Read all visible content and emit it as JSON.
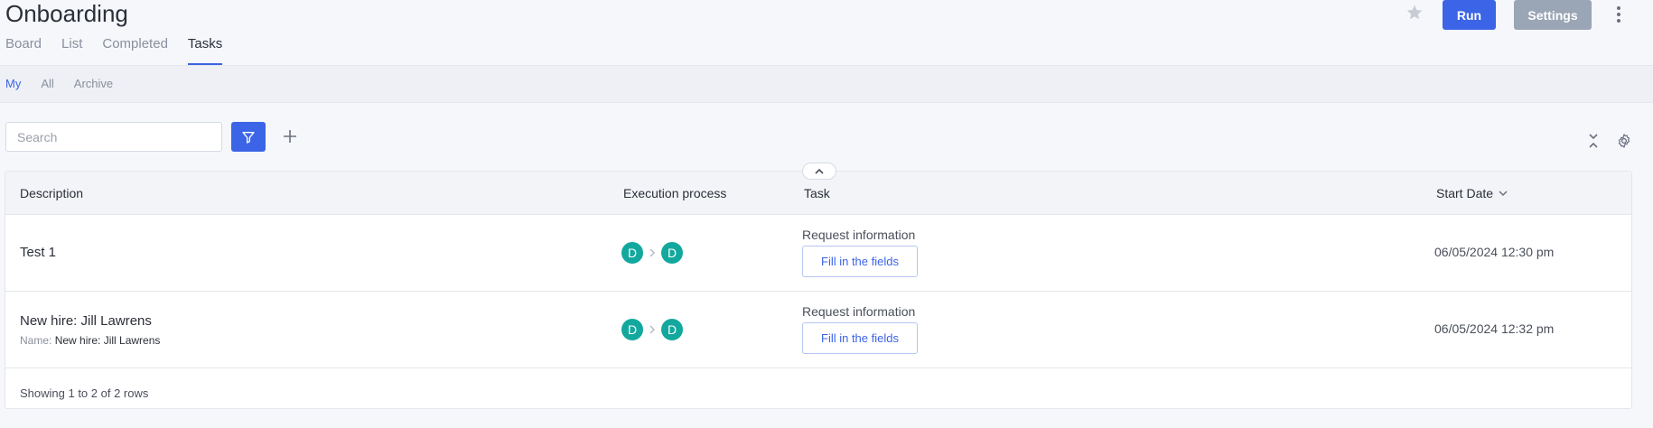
{
  "header": {
    "title": "Onboarding",
    "tabs": [
      {
        "label": "Board"
      },
      {
        "label": "List"
      },
      {
        "label": "Completed"
      },
      {
        "label": "Tasks"
      }
    ],
    "active_tab": "Tasks",
    "run_label": "Run",
    "settings_label": "Settings"
  },
  "subtabs": {
    "items": [
      {
        "label": "My"
      },
      {
        "label": "All"
      },
      {
        "label": "Archive"
      }
    ],
    "active": "My"
  },
  "toolbar": {
    "search_placeholder": "Search",
    "search_value": ""
  },
  "table": {
    "columns": {
      "description": "Description",
      "execution": "Execution process",
      "task": "Task",
      "start_date": "Start Date"
    },
    "rows": [
      {
        "description": "Test 1",
        "sub_label": "",
        "sub_value": "",
        "exec_from": "D",
        "exec_to": "D",
        "task_label": "Request information",
        "task_button": "Fill in the fields",
        "start_date": "06/05/2024 12:30 pm"
      },
      {
        "description": "New hire: Jill Lawrens",
        "sub_label": "Name:",
        "sub_value": "New hire: Jill Lawrens",
        "exec_from": "D",
        "exec_to": "D",
        "task_label": "Request information",
        "task_button": "Fill in the fields",
        "start_date": "06/05/2024 12:32 pm"
      }
    ],
    "footer": "Showing 1 to 2 of 2 rows"
  },
  "colors": {
    "accent": "#3c64e6",
    "avatar": "#13a89e",
    "settings_button": "#9aa5b5"
  },
  "icons": [
    "star-icon",
    "more-vertical-icon",
    "filter-icon",
    "plus-icon",
    "collapse-icon",
    "gear-icon",
    "chevron-up-icon",
    "chevron-down-icon",
    "chevron-right-icon"
  ]
}
